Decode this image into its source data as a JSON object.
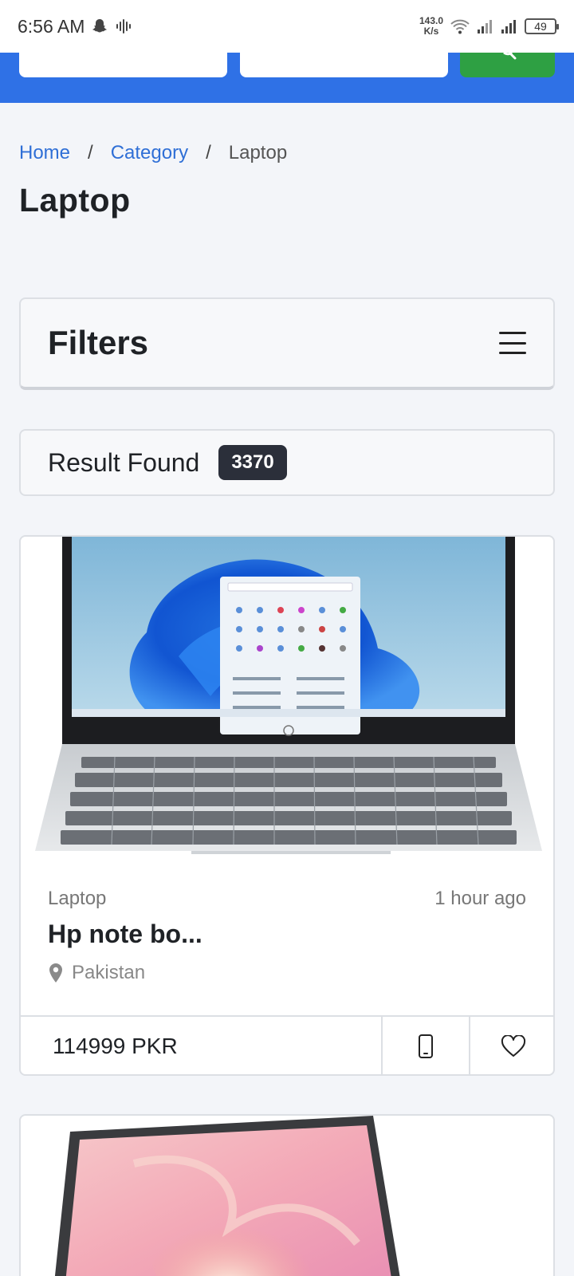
{
  "status_bar": {
    "time": "6:56 AM",
    "net_speed_value": "143.0",
    "net_speed_unit": "K/s",
    "battery": "49"
  },
  "breadcrumb": {
    "home": "Home",
    "category": "Category",
    "current": "Laptop",
    "separator": "/"
  },
  "page": {
    "title": "Laptop"
  },
  "filters": {
    "title": "Filters"
  },
  "results": {
    "label": "Result Found",
    "count": "3370"
  },
  "products": [
    {
      "category": "Laptop",
      "posted": "1 hour ago",
      "title": "Hp note bo...",
      "location": "Pakistan",
      "price": "114999 PKR"
    }
  ],
  "icons": {
    "filter_toggle": "hamburger-menu-icon",
    "location": "map-pin-icon",
    "contact": "phone-icon",
    "favorite": "heart-icon"
  },
  "colors": {
    "header_blue": "#2f71e6",
    "search_green": "#2ea043",
    "link_blue": "#2f6fd6",
    "badge_dark": "#2b2f3a"
  }
}
